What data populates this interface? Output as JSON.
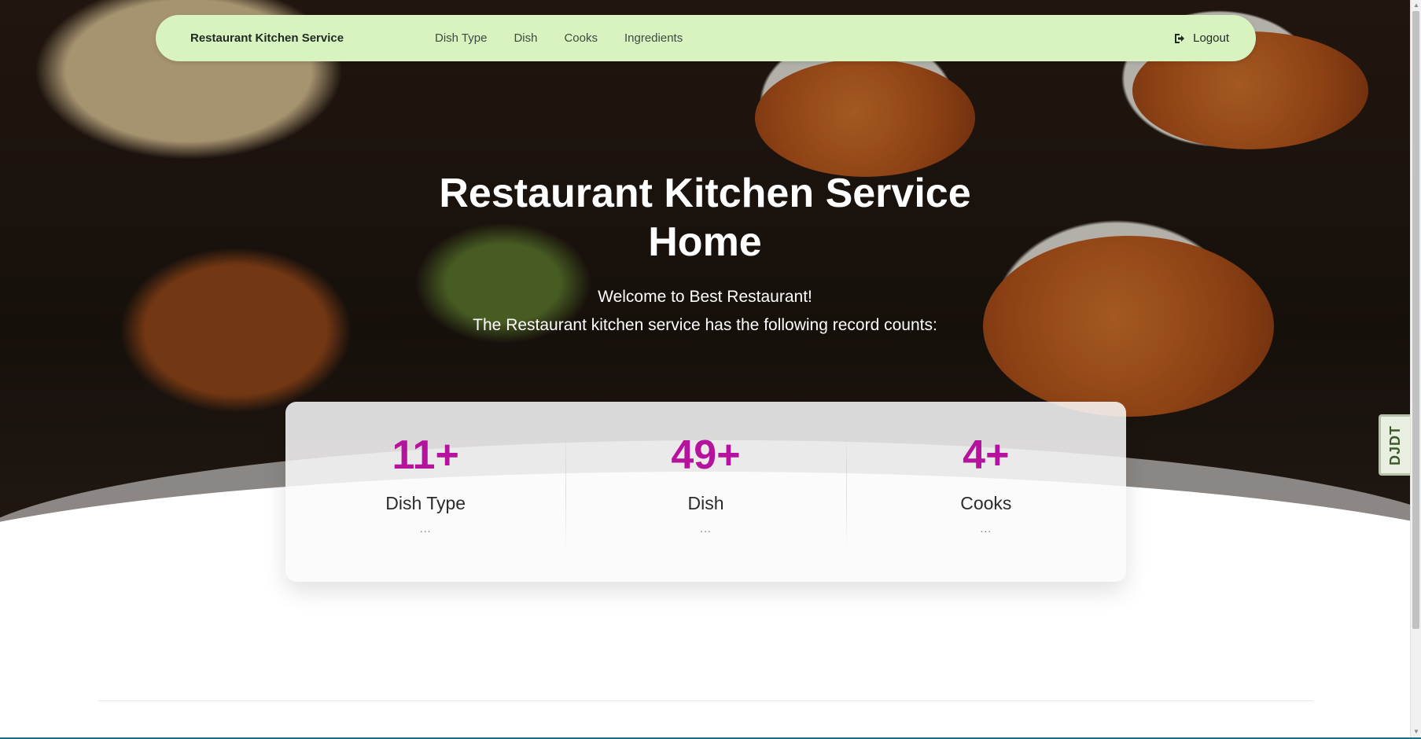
{
  "navbar": {
    "brand": "Restaurant Kitchen Service",
    "links": [
      "Dish Type",
      "Dish",
      "Cooks",
      "Ingredients"
    ],
    "logout_label": "Logout"
  },
  "hero": {
    "title_line1": "Restaurant Kitchen Service",
    "title_line2": "Home",
    "welcome": "Welcome to Best Restaurant!",
    "subtitle": "The Restaurant kitchen service has the following record counts:"
  },
  "stats": [
    {
      "value": "11+",
      "label": "Dish Type",
      "more": "..."
    },
    {
      "value": "49+",
      "label": "Dish",
      "more": "..."
    },
    {
      "value": "4+",
      "label": "Cooks",
      "more": "..."
    }
  ],
  "debug_toolbar": {
    "label": "DJDT"
  },
  "colors": {
    "navbar_bg": "#d9f3c0",
    "stat_value": "#b5139e",
    "hero_text": "#ffffff"
  }
}
